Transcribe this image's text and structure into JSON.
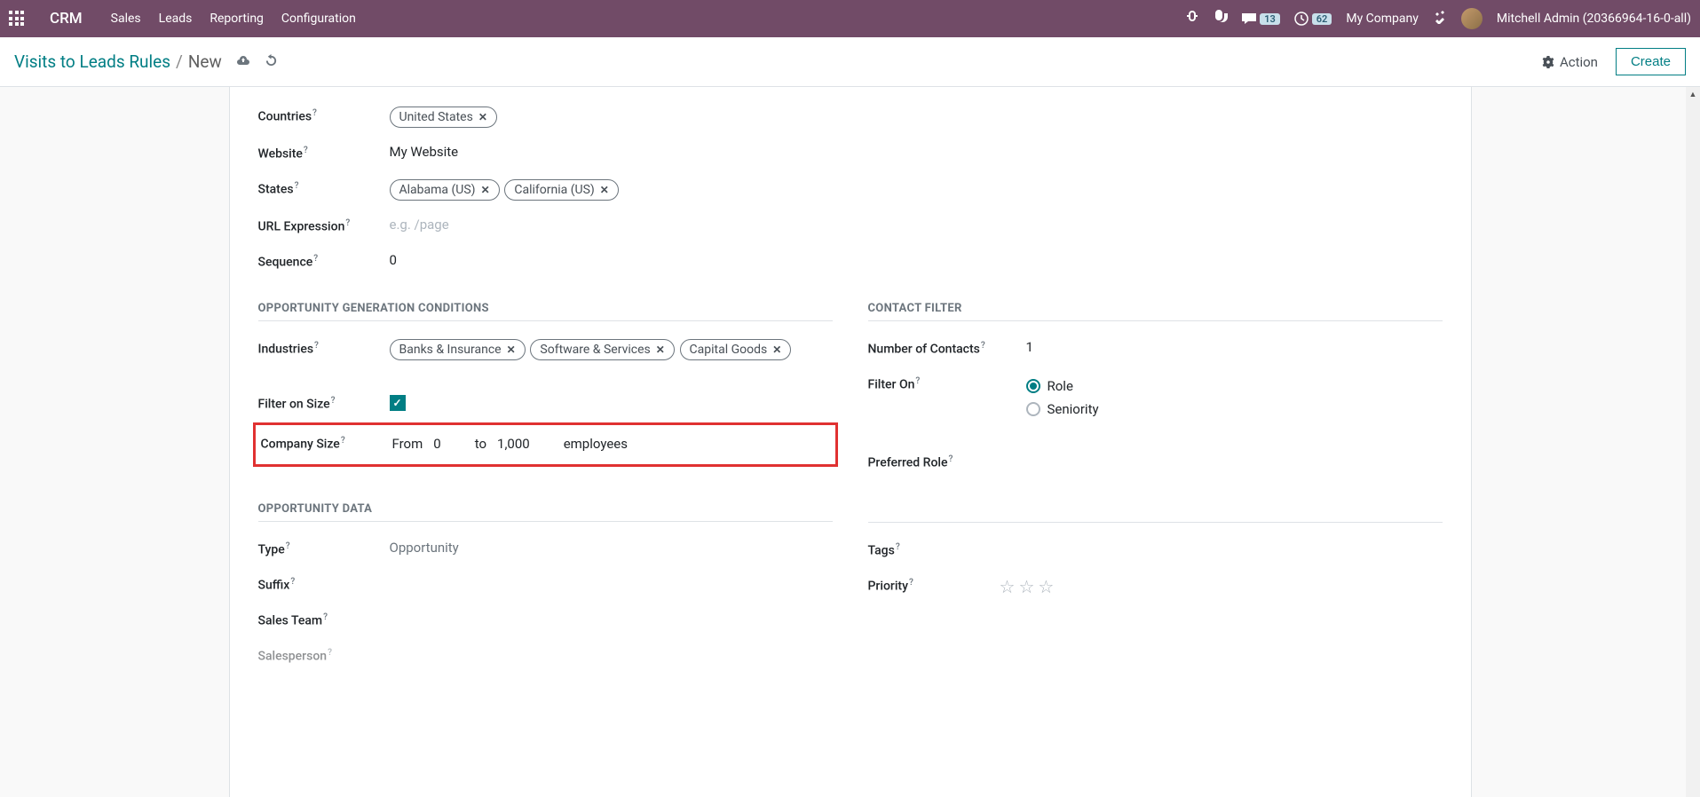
{
  "topbar": {
    "brand": "CRM",
    "nav": [
      "Sales",
      "Leads",
      "Reporting",
      "Configuration"
    ],
    "messages_count": "13",
    "activities_count": "62",
    "company": "My Company",
    "user": "Mitchell Admin (20366964-16-0-all)"
  },
  "breadcrumb": {
    "parent": "Visits to Leads Rules",
    "current": "New",
    "action_label": "Action",
    "create_label": "Create"
  },
  "fields": {
    "countries_label": "Countries",
    "countries_tags": [
      "United States"
    ],
    "website_label": "Website",
    "website_value": "My Website",
    "states_label": "States",
    "states_tags": [
      "Alabama (US)",
      "California (US)"
    ],
    "url_label": "URL Expression",
    "url_placeholder": "e.g. /page",
    "sequence_label": "Sequence",
    "sequence_value": "0"
  },
  "sections": {
    "conditions": "OPPORTUNITY GENERATION CONDITIONS",
    "contact_filter": "CONTACT FILTER",
    "opp_data": "OPPORTUNITY DATA"
  },
  "conditions": {
    "industries_label": "Industries",
    "industries_tags": [
      "Banks & Insurance",
      "Software & Services",
      "Capital Goods"
    ],
    "filter_size_label": "Filter on Size",
    "filter_size_checked": true,
    "company_size_label": "Company Size",
    "size_from": "From",
    "size_from_val": "0",
    "size_to": "to",
    "size_to_val": "1,000",
    "size_unit": "employees"
  },
  "contact_filter": {
    "num_contacts_label": "Number of Contacts",
    "num_contacts_value": "1",
    "filter_on_label": "Filter On",
    "option_role": "Role",
    "option_seniority": "Seniority",
    "preferred_role_label": "Preferred Role"
  },
  "opp_data": {
    "type_label": "Type",
    "type_value": "Opportunity",
    "suffix_label": "Suffix",
    "sales_team_label": "Sales Team",
    "salesperson_label": "Salesperson",
    "tags_label": "Tags",
    "priority_label": "Priority"
  }
}
